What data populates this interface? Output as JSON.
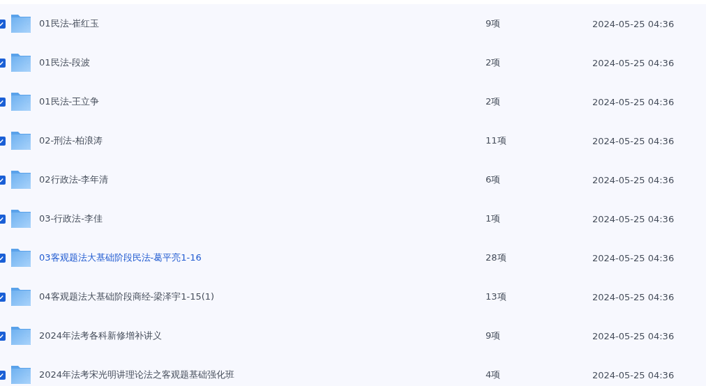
{
  "files": [
    {
      "name": "01民法-崔红玉",
      "count": "9项",
      "date": "2024-05-25 04:36",
      "checked": true,
      "hovered": false
    },
    {
      "name": "01民法-段波",
      "count": "2项",
      "date": "2024-05-25 04:36",
      "checked": true,
      "hovered": false
    },
    {
      "name": "01民法-王立争",
      "count": "2项",
      "date": "2024-05-25 04:36",
      "checked": true,
      "hovered": false
    },
    {
      "name": "02-刑法-柏浪涛",
      "count": "11项",
      "date": "2024-05-25 04:36",
      "checked": true,
      "hovered": false
    },
    {
      "name": "02行政法-李年清",
      "count": "6项",
      "date": "2024-05-25 04:36",
      "checked": true,
      "hovered": false
    },
    {
      "name": "03-行政法-李佳",
      "count": "1项",
      "date": "2024-05-25 04:36",
      "checked": true,
      "hovered": false
    },
    {
      "name": "03客观题法大基础阶段民法-葛平亮1-16",
      "count": "28项",
      "date": "2024-05-25 04:36",
      "checked": true,
      "hovered": true
    },
    {
      "name": "04客观题法大基础阶段商经-梁泽宇1-15(1)",
      "count": "13项",
      "date": "2024-05-25 04:36",
      "checked": true,
      "hovered": false
    },
    {
      "name": "2024年法考各科新修增补讲义",
      "count": "9项",
      "date": "2024-05-25 04:36",
      "checked": true,
      "hovered": false
    },
    {
      "name": "2024年法考宋光明讲理论法之客观题基础强化班",
      "count": "4项",
      "date": "2024-05-25 04:36",
      "checked": true,
      "hovered": false
    }
  ]
}
